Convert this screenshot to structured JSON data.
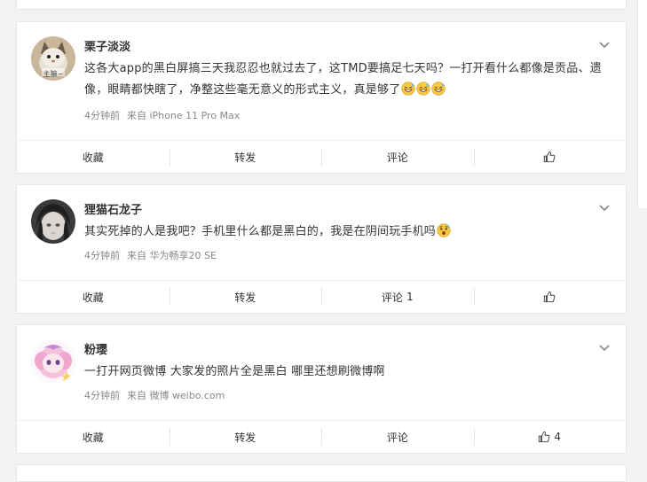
{
  "posts": [
    {
      "username": "栗子淡淡",
      "avatar_caption": "主嘛~",
      "text": "这各大app的黑白屏搞三天我忍忍也就过去了，这TMD要搞足七天吗？一打开看什么都像是贡品、遗像，眼睛都快瞎了，净整这些毫无意义的形式主义，真是够了",
      "emojis": [
        "grin-sweat-emoji",
        "grin-sweat-emoji",
        "grin-sweat-emoji"
      ],
      "time": "4分钟前",
      "source": "来自 iPhone 11 Pro Max",
      "actions": {
        "collect": "收藏",
        "repost": "转发",
        "comment": "评论",
        "comment_count": "",
        "like_count": ""
      }
    },
    {
      "username": "狸猫石龙子",
      "text": "其实死掉的人是我吧？手机里什么都是黑白的，我是在阴间玩手机吗",
      "emojis": [
        "surprised-emoji"
      ],
      "time": "4分钟前",
      "source": "来自 华为畅享20 SE",
      "actions": {
        "collect": "收藏",
        "repost": "转发",
        "comment": "评论",
        "comment_count": "1",
        "like_count": ""
      }
    },
    {
      "username": "粉璎",
      "text": "一打开网页微博 大家发的照片全是黑白 哪里还想刷微博啊",
      "emojis": [],
      "time": "4分钟前",
      "source": "来自 微博 weibo.com",
      "actions": {
        "collect": "收藏",
        "repost": "转发",
        "comment": "评论",
        "comment_count": "",
        "like_count": "4"
      }
    }
  ]
}
